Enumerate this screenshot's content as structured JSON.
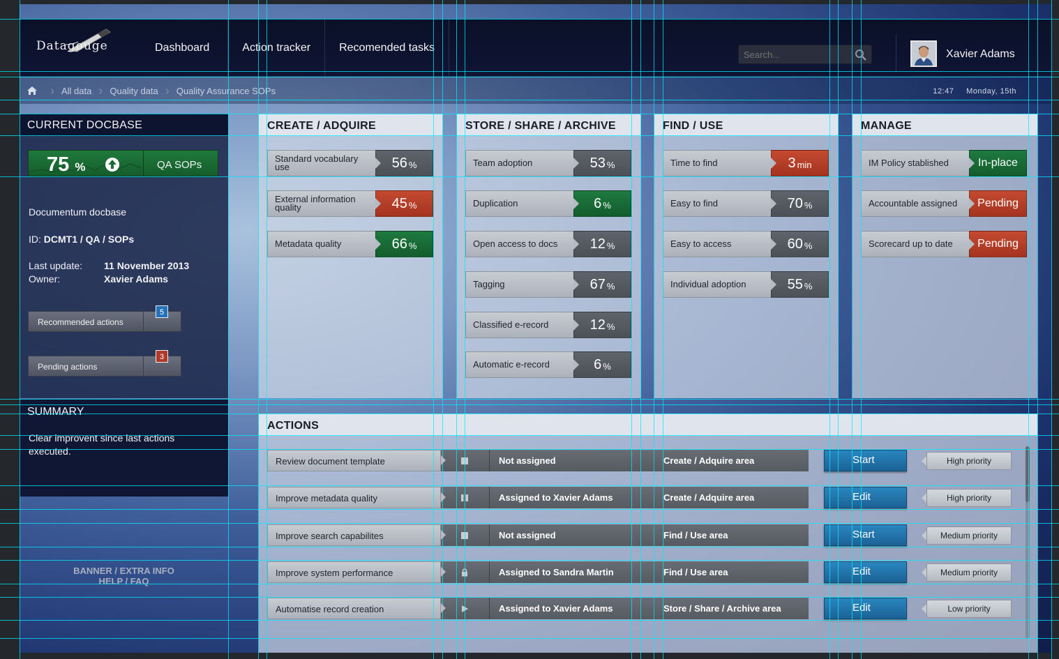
{
  "app": {
    "logo_text": "Datagouge"
  },
  "nav": [
    "Dashboard",
    "Action tracker",
    "Recomended tasks"
  ],
  "search": {
    "placeholder": "Search..."
  },
  "user": {
    "name": "Xavier Adams"
  },
  "breadcrumb": [
    "All data",
    "Quality data",
    "Quality Assurance SOPs"
  ],
  "clock": {
    "time": "12:47",
    "date": "Monday, 15th"
  },
  "docbase": {
    "title": "CURRENT DOCBASE",
    "score": "75",
    "score_unit": "%",
    "score_label": "QA SOPs",
    "name": "Documentum docbase",
    "id_label": "ID:",
    "id_value": "DCMT1 / QA / SOPs",
    "last_update_label": "Last update:",
    "last_update_value": "11 November 2013",
    "owner_label": "Owner:",
    "owner_value": "Xavier Adams",
    "recommended_label": "Recommended actions",
    "recommended_count": "5",
    "pending_label": "Pending actions",
    "pending_count": "3"
  },
  "summary": {
    "title": "SUMMARY",
    "text": "Clear improvent since last actions executed."
  },
  "banner": {
    "line1": "BANNER / EXTRA INFO",
    "line2": "HELP / FAQ"
  },
  "columns": [
    {
      "title": "CREATE / ADQUIRE",
      "metrics": [
        {
          "label": "Standard vocabulary use",
          "value": "56",
          "unit": "%",
          "status": "gray"
        },
        {
          "label": "External information quality",
          "value": "45",
          "unit": "%",
          "status": "red"
        },
        {
          "label": "Metadata quality",
          "value": "66",
          "unit": "%",
          "status": "green"
        }
      ]
    },
    {
      "title": "STORE / SHARE / ARCHIVE",
      "metrics": [
        {
          "label": "Team adoption",
          "value": "53",
          "unit": "%",
          "status": "gray"
        },
        {
          "label": "Duplication",
          "value": "6",
          "unit": "%",
          "status": "green"
        },
        {
          "label": "Open access to docs",
          "value": "12",
          "unit": "%",
          "status": "gray"
        },
        {
          "label": "Tagging",
          "value": "67",
          "unit": "%",
          "status": "gray"
        },
        {
          "label": "Classified e-record",
          "value": "12",
          "unit": "%",
          "status": "gray"
        },
        {
          "label": "Automatic e-record",
          "value": "6",
          "unit": "%",
          "status": "gray"
        }
      ]
    },
    {
      "title": "FIND / USE",
      "metrics": [
        {
          "label": "Time to find",
          "value": "3",
          "unit": "min",
          "status": "red"
        },
        {
          "label": "Easy to find",
          "value": "70",
          "unit": "%",
          "status": "gray"
        },
        {
          "label": "Easy to access",
          "value": "60",
          "unit": "%",
          "status": "gray"
        },
        {
          "label": "Individual adoption",
          "value": "55",
          "unit": "%",
          "status": "gray"
        }
      ]
    },
    {
      "title": "MANAGE",
      "metrics": [
        {
          "label": "IM Policy stablished",
          "value": "In-place",
          "unit": "",
          "status": "green"
        },
        {
          "label": "Accountable assigned",
          "value": "Pending",
          "unit": "",
          "status": "red"
        },
        {
          "label": "Scorecard up to date",
          "value": "Pending",
          "unit": "",
          "status": "red"
        }
      ]
    }
  ],
  "actions": {
    "title": "ACTIONS",
    "rows": [
      {
        "task": "Review document template",
        "state_icon": "stop-icon",
        "assignee": "Not assigned",
        "area": "Create / Adquire area",
        "button": "Start",
        "priority": "High priority"
      },
      {
        "task": "Improve metadata quality",
        "state_icon": "pause-icon",
        "assignee": "Assigned to Xavier Adams",
        "area": "Create / Adquire area",
        "button": "Edit",
        "priority": "High priority"
      },
      {
        "task": "Improve search capabilites",
        "state_icon": "stop-icon",
        "assignee": "Not assigned",
        "area": "Find / Use area",
        "button": "Start",
        "priority": "Medium priority"
      },
      {
        "task": "Improve system performance",
        "state_icon": "lock-icon",
        "assignee": "Assigned to Sandra Martin",
        "area": "Find / Use area",
        "button": "Edit",
        "priority": "Medium priority"
      },
      {
        "task": "Automatise record creation",
        "state_icon": "play-icon",
        "assignee": "Assigned to Xavier Adams",
        "area": "Store / Share / Archive area",
        "button": "Edit",
        "priority": "Low priority"
      }
    ]
  },
  "colors": {
    "green": "#1e7a40",
    "red": "#b8402a",
    "blue": "#2372aa",
    "gray": "#585c63"
  }
}
